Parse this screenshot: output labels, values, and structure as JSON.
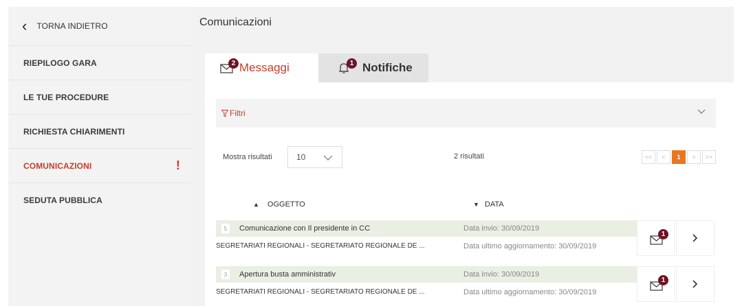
{
  "sidebar": {
    "back_label": "TORNA INDIETRO",
    "items": [
      {
        "label": "RIEPILOGO GARA"
      },
      {
        "label": "LE TUE PROCEDURE"
      },
      {
        "label": "RICHIESTA CHIARIMENTI"
      },
      {
        "label": "COMUNICAZIONI",
        "alert": "!"
      },
      {
        "label": "SEDUTA PUBBLICA"
      }
    ]
  },
  "header": {
    "title": "Comunicazioni"
  },
  "tabs": [
    {
      "label": "Messaggi",
      "badge": "2",
      "icon": "envelope-icon"
    },
    {
      "label": "Notifiche",
      "badge": "1",
      "icon": "bell-icon"
    }
  ],
  "filters": {
    "label": "Filtri"
  },
  "results": {
    "show_label": "Mostra risultati",
    "page_size": "10",
    "count_text": "2 risultati",
    "pager": [
      "<<",
      "<",
      "1",
      ">",
      ">>"
    ],
    "current_page": "1"
  },
  "columns": {
    "subject": "OGGETTO",
    "date": "DATA"
  },
  "messages": [
    {
      "num": "5",
      "subject": "Comunicazione con Il presidente in CC",
      "date": "Data invio: 30/09/2019",
      "sender": "SEGRETARIATI REGIONALI - SEGRETARIATO REGIONALE DE ...",
      "updated": "Data ultimo aggiornamento: 30/09/2019",
      "badge": "1"
    },
    {
      "num": "3",
      "subject": "Apertura busta amministrativ",
      "date": "Data invio: 30/09/2019",
      "sender": "SEGRETARIATI REGIONALI - SEGRETARIATO REGIONALE DE ...",
      "updated": "Data ultimo aggiornamento: 30/09/2019",
      "badge": "1"
    }
  ],
  "colors": {
    "accent": "#c43e2b",
    "badge": "#6e1423",
    "pager_active": "#e87722",
    "row_highlight": "#e9efe3"
  }
}
